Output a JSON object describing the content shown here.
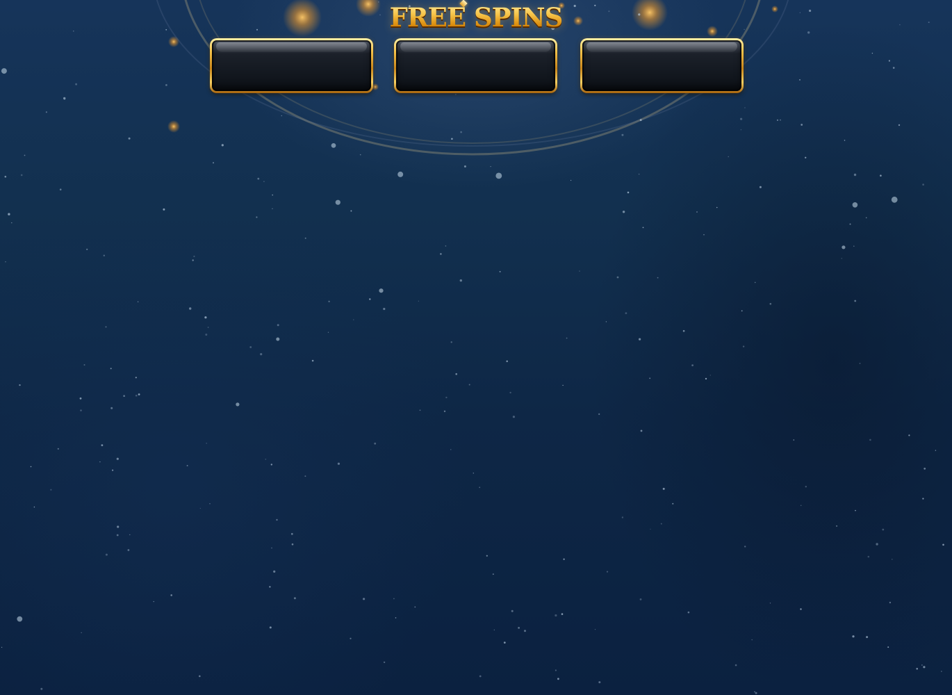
{
  "game": {
    "title": "FREE SPINS",
    "panels": [
      {
        "id": "panel-1",
        "value": ""
      },
      {
        "id": "panel-2",
        "value": ""
      },
      {
        "id": "panel-3",
        "value": ""
      }
    ]
  },
  "colors": {
    "background": "#0c2240",
    "gold_accent": "#f6b21f",
    "panel_fill": "#151a22"
  },
  "icons": [
    "title-gem-icon"
  ]
}
